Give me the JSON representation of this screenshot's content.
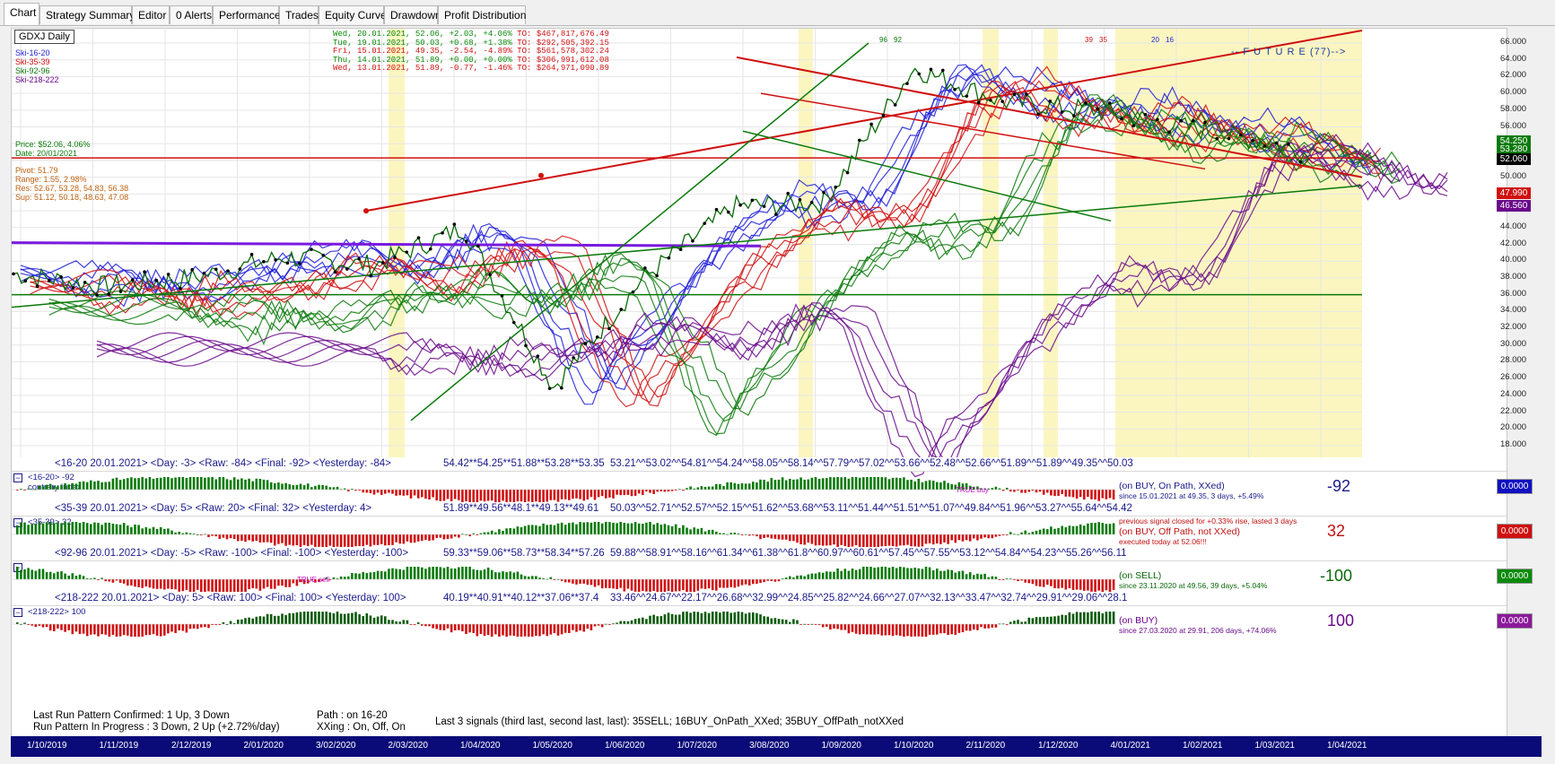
{
  "tabs": [
    "Chart",
    "Strategy Summary",
    "Editor",
    "0 Alerts",
    "Performance",
    "Trades",
    "Equity Curve",
    "Drawdown",
    "Profit Distribution"
  ],
  "symbol": "GDXJ Daily",
  "legend": [
    "Ski-16-20",
    "Ski-35-39",
    "Ski-92-96",
    "Ski-218-222"
  ],
  "colors": {
    "blue": "#1f1fd8",
    "red": "#d01010",
    "green": "#0a7a0a",
    "purple": "#6a0a8a",
    "magenta": "#e010e0",
    "highlight": "#fbf6c0",
    "axis": "#0a0a78"
  },
  "price_info": {
    "price": "Price: $52.06, 4.06%",
    "date": "Date: 20/01/2021"
  },
  "pivot_info": {
    "pivot": "Pivot: 51.79",
    "range": "Range: 1.55, 2.98%",
    "res": "Res: 52.67, 53.28, 54.83, 56.38",
    "sup": "Sup: 51.12, 50.18, 48.63, 47.08"
  },
  "daily_rows": [
    {
      "text": "Wed, 20.01.2021, 52.06, +2.03, +4.06%",
      "to": "TO: $467,817,676.49",
      "color": "#0a8a0a"
    },
    {
      "text": "Tue, 19.01.2021, 50.03, +0.68, +1.38%",
      "to": "TO: $292,505,392.15",
      "color": "#0a8a0a"
    },
    {
      "text": "Fri, 15.01.2021, 49.35, -2.54, -4.89%",
      "to": "TO: $561,578,302.24",
      "color": "#d01010"
    },
    {
      "text": "Thu, 14.01.2021, 51.89, +0.00, +0.00%",
      "to": "TO: $306,991,612.08",
      "color": "#0a8a0a"
    },
    {
      "text": "Wed, 13.01.2021, 51.89, -0.77, -1.46%",
      "to": "TO: $264,971,090.89",
      "color": "#d01010"
    }
  ],
  "future_label": "-- F U T U R E (77)-->",
  "top_markers": [
    {
      "text": "96",
      "color": "#0a7a0a"
    },
    {
      "text": "92",
      "color": "#0a7a0a"
    },
    {
      "text": "39",
      "color": "#d01010"
    },
    {
      "text": "35",
      "color": "#d01010"
    },
    {
      "text": "20",
      "color": "#1f1fd8"
    },
    {
      "text": "16",
      "color": "#1f1fd8"
    }
  ],
  "y_axis": [
    "66.000",
    "64.000",
    "62.000",
    "60.000",
    "58.000",
    "56.000",
    "54.000",
    "52.000",
    "50.000",
    "48.000",
    "46.000",
    "44.000",
    "42.000",
    "40.000",
    "38.000",
    "36.000",
    "34.000",
    "32.000",
    "30.000",
    "28.000",
    "26.000",
    "24.000",
    "22.000",
    "20.000",
    "18.000"
  ],
  "price_labels": [
    {
      "text": "54.250",
      "color": "#0a7a0a"
    },
    {
      "text": "53.280",
      "color": "#0a7a0a"
    },
    {
      "text": "52.060",
      "color": "#000000"
    },
    {
      "text": "47.990",
      "color": "#d01010"
    },
    {
      "text": "46.560",
      "color": "#6a0a8a"
    }
  ],
  "x_axis": [
    "1/10/2019",
    "1/11/2019",
    "2/12/2019",
    "2/01/2020",
    "3/02/2020",
    "2/03/2020",
    "1/04/2020",
    "1/05/2020",
    "1/06/2020",
    "1/07/2020",
    "3/08/2020",
    "1/09/2020",
    "1/10/2020",
    "2/11/2020",
    "1/12/2020",
    "4/01/2021",
    "1/02/2021",
    "1/03/2021",
    "1/04/2021"
  ],
  "indicators": [
    {
      "header": "<16-20  20.01.2021>  <Day: -3>  <Raw: -84>  <Final: -92>  <Yesterday: -84>",
      "seq1": "54.42**54.25**51.88**53.28**53.35",
      "seq2": "53.21^^53.02^^54.81^^54.24^^58.05^^58.14^^57.79^^57.02^^53.66^^52.48^^52.66^^51.89^^51.89^^49.35^^50.03",
      "tag": "<16-20>  -92",
      "sub": "contrary index",
      "note1": "(on BUY, On Path, XXed)",
      "note2": "since 15.01.2021 at 49.35, 3 days, +5.49%",
      "note_color": "#1a1a8c",
      "extra": "TRUE buy",
      "big": "-92",
      "big_color": "#1a1a8c",
      "box": "0.0000",
      "box_color": "#1010c0"
    },
    {
      "header": "<35-39  20.01.2021>  <Day: 5>  <Raw: 20>  <Final: 32>  <Yesterday: 4>",
      "seq1": "51.89**49.56**48.1**49.13**49.61",
      "seq2": "50.03^^52.71^^52.57^^52.15^^51.62^^53.68^^53.11^^51.44^^51.51^^51.07^^49.84^^51.96^^53.27^^55.64^^54.42",
      "tag": "<35-39>  32",
      "sub": "",
      "note0": "previous signal closed for +0.33% rise, lasted 3 days",
      "note1": "(on BUY, Off Path, not XXed)",
      "note2": "executed today at 52.06!!!",
      "note_color": "#c01010",
      "extra": "",
      "big": "32",
      "big_color": "#c01010",
      "box": "0.0000",
      "box_color": "#d01010"
    },
    {
      "header": "<92-96  20.01.2021>  <Day: -5>  <Raw: -100>  <Final: -100>  <Yesterday: -100>",
      "seq1": "59.33**59.06**58.73**58.34**57.26",
      "seq2": "59.88^^58.91^^58.16^^61.34^^61.38^^61.8^^60.97^^60.61^^57.45^^57.55^^53.12^^54.84^^54.23^^55.26^^56.11",
      "tag": "",
      "sub": "",
      "note1": "(on SELL)",
      "note2": "since 23.11.2020 at 49.56, 39 days, +5.04%",
      "note_color": "#0a6a0a",
      "extra": "TRUE sell",
      "big": "-100",
      "big_color": "#0a6a0a",
      "box": "0.0000",
      "box_color": "#0a8a0a"
    },
    {
      "header": "<218-222  20.01.2021>  <Day: 5>  <Raw: 100>  <Final: 100>  <Yesterday: 100>",
      "seq1": "40.19**40.91**40.12**37.06**37.4",
      "seq2": "33.46^^24.67^^22.17^^26.68^^32.99^^24.85^^25.82^^24.66^^27.07^^32.13^^33.47^^32.74^^29.91^^29.06^^28.1",
      "tag": "<218-222>  100",
      "sub": "",
      "note1": "(on BUY)",
      "note2": "since 27.03.2020 at 29.91, 206 days, +74.06%",
      "note_color": "#6a0a8a",
      "extra": "",
      "big": "100",
      "big_color": "#6a0a8a",
      "box": "0.0000",
      "box_color": "#8a1a9a"
    }
  ],
  "bottom": {
    "l1": "Last Run Pattern Confirmed: 1 Up, 3 Down",
    "l2": "Run Pattern In Progress     : 3 Down, 2 Up  (+2.72%/day)",
    "p1": "Path   : on 16-20",
    "p2": "XXing : On, Off, On",
    "signals": "Last 3 signals (third last, second last, last): 35SELL;  16BUY_OnPath_XXed;  35BUY_OffPath_notXXed"
  },
  "chart_data": {
    "type": "line",
    "title": "GDXJ Daily",
    "ylim": [
      17,
      67
    ],
    "x": [
      "1/10/2019",
      "1/11/2019",
      "2/12/2019",
      "2/01/2020",
      "3/02/2020",
      "2/03/2020",
      "1/04/2020",
      "1/05/2020",
      "1/06/2020",
      "1/07/2020",
      "3/08/2020",
      "1/09/2020",
      "1/10/2020",
      "2/11/2020",
      "1/12/2020",
      "4/01/2021"
    ],
    "series": [
      {
        "name": "",
        "values": [
          38.5,
          37.0,
          38.0,
          40.5,
          39.5,
          44.0,
          25.0,
          38.0,
          46.5,
          47.0,
          63.0,
          59.0,
          58.0,
          56.0,
          54.0,
          51.0
        ]
      }
    ],
    "final_close": 52.06
  }
}
